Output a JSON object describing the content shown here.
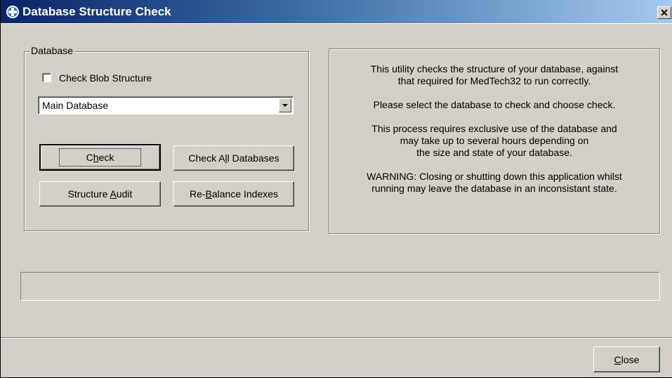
{
  "window": {
    "title": "Database Structure Check",
    "close_glyph": "✕"
  },
  "database_group": {
    "legend": "Database",
    "check_blob_label": "Check Blob Structure",
    "check_blob_checked": false,
    "database_select_value": "Main Database"
  },
  "buttons": {
    "check_pre": "C",
    "check_u": "h",
    "check_post": "eck",
    "check_all_pre": "Check A",
    "check_all_u": "l",
    "check_all_post": "l Databases",
    "audit_pre": "Structure ",
    "audit_u": "A",
    "audit_post": "udit",
    "rebalance_pre": "Re-",
    "rebalance_u": "B",
    "rebalance_post": "alance Indexes",
    "close_u": "C",
    "close_post": "lose"
  },
  "info": {
    "p1_line1": "This utility checks the structure of your database, against",
    "p1_line2": "that required for MedTech32 to run correctly.",
    "p2": "Please select the database to check and choose check.",
    "p3_line1": "This process requires exclusive use of the database and",
    "p3_line2": "may take up to several hours depending on",
    "p3_line3": "the size and state of your database.",
    "p4_line1": "WARNING: Closing or shutting down this application whilst",
    "p4_line2": "running may leave the database in an inconsistant state."
  },
  "progress": {
    "value": 0
  },
  "colors": {
    "face": "#d4d0c8",
    "title_start": "#0a246a",
    "title_end": "#a6caf0"
  },
  "icons": {
    "app": "medtech-cross-icon",
    "close": "close-icon",
    "dropdown": "chevron-down-icon"
  }
}
